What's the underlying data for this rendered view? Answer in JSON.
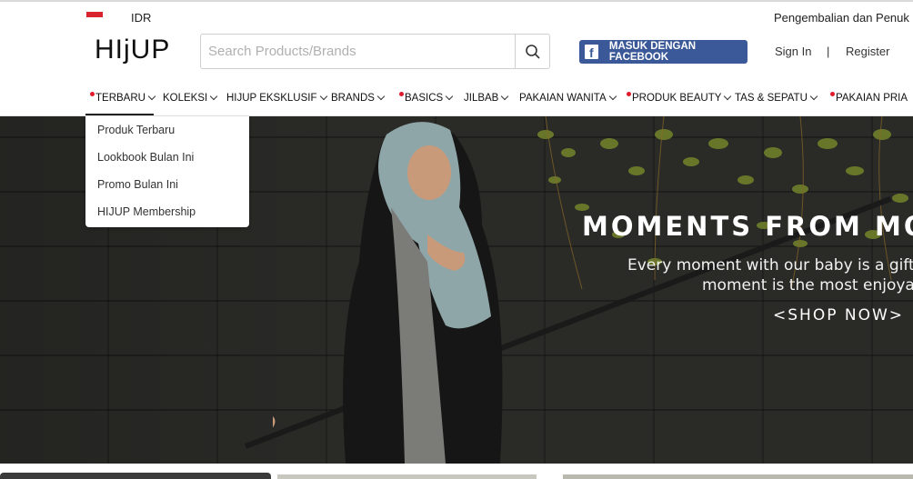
{
  "topbar": {
    "currency": "IDR",
    "returns_text": "Pengembalian dan Penuk"
  },
  "header": {
    "logo": "HIjUP",
    "search_placeholder": "Search Products/Brands",
    "facebook_login": "MASUK DENGAN FACEBOOK",
    "sign_in": "Sign In",
    "separator": "|",
    "register": "Register"
  },
  "nav": {
    "items": [
      {
        "label": "TERBARU",
        "dot": true
      },
      {
        "label": "KOLEKSI",
        "dot": false
      },
      {
        "label": "HIJUP EKSKLUSIF",
        "dot": false
      },
      {
        "label": "BRANDS",
        "dot": false
      },
      {
        "label": "BASICS",
        "dot": true
      },
      {
        "label": "JILBAB",
        "dot": false
      },
      {
        "label": "PAKAIAN WANITA",
        "dot": false
      },
      {
        "label": "PRODUK BEAUTY",
        "dot": true
      },
      {
        "label": "TAS & SEPATU",
        "dot": false
      },
      {
        "label": "PAKAIAN PRIA",
        "dot": true
      }
    ]
  },
  "dropdown": {
    "items": [
      "Produk Terbaru",
      "Lookbook Bulan Ini",
      "Promo Bulan Ini",
      "HIJUP Membership"
    ]
  },
  "hero": {
    "headline": "MOMENTS FROM MO",
    "subtitle_line1": "Every moment with our baby is a gift a",
    "subtitle_line2": "moment is the most enjoyab",
    "cta": "<SHOP NOW>"
  },
  "colors": {
    "facebook": "#3b5998",
    "accent_dot": "#e01a2b",
    "flag_red": "#d9232e"
  }
}
